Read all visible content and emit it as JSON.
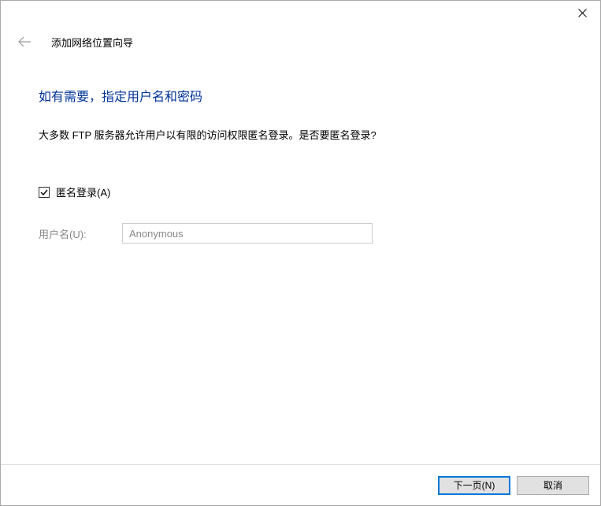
{
  "wizard": {
    "title": "添加网络位置向导"
  },
  "page": {
    "heading": "如有需要，指定用户名和密码",
    "description": "大多数 FTP 服务器允许用户以有限的访问权限匿名登录。是否要匿名登录?"
  },
  "form": {
    "anonymous_label": "匿名登录(A)",
    "anonymous_checked": true,
    "username_label": "用户名(U):",
    "username_value": "Anonymous"
  },
  "footer": {
    "next_label": "下一页(N)",
    "cancel_label": "取消"
  }
}
